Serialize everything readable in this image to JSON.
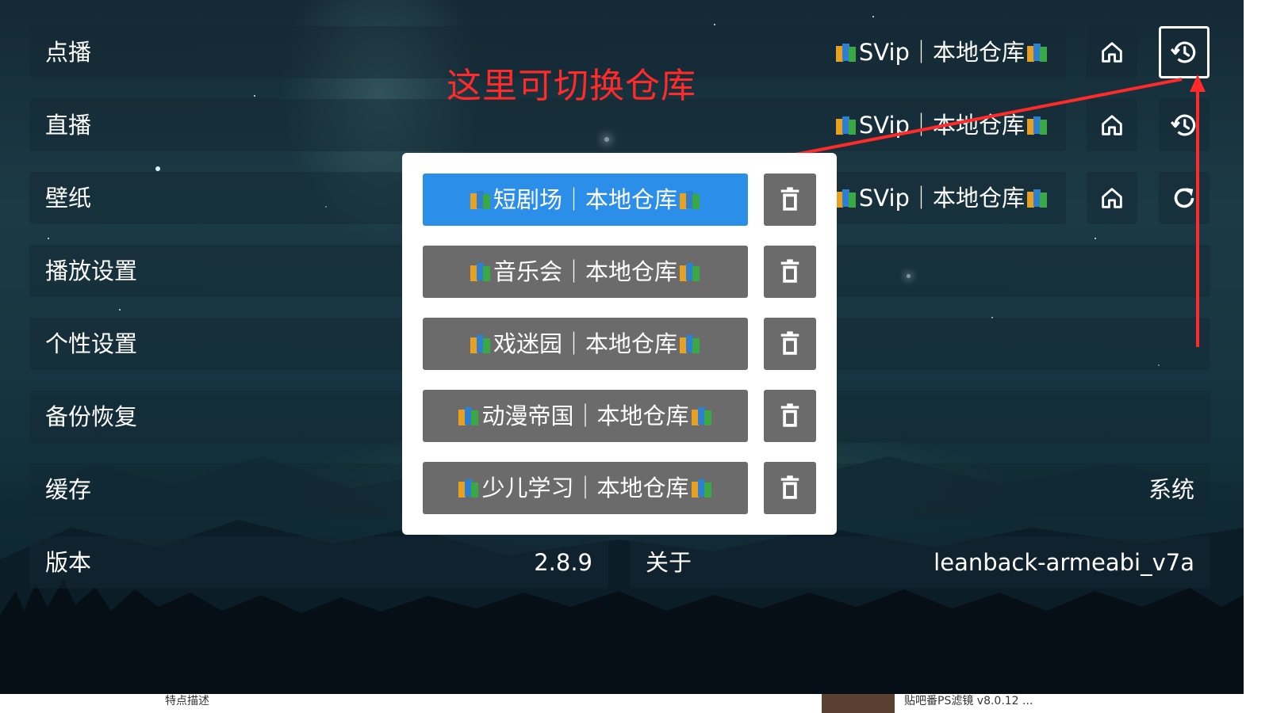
{
  "settings": {
    "rows": [
      {
        "label": "点播",
        "value_name": "SVip",
        "value_repo": "本地仓库"
      },
      {
        "label": "直播",
        "value_name": "SVip",
        "value_repo": "本地仓库"
      },
      {
        "label": "壁纸",
        "value_name": "SVip",
        "value_repo": "本地仓库"
      },
      {
        "label": "播放设置"
      },
      {
        "label": "个性设置"
      },
      {
        "label": "备份恢复"
      },
      {
        "label": "缓存",
        "value": "系统"
      }
    ],
    "version": {
      "label": "版本",
      "value": "2.8.9"
    },
    "about": {
      "label": "关于",
      "value": "leanback-armeabi_v7a"
    },
    "separator": "｜"
  },
  "annotation": {
    "text": "这里可切换仓库",
    "color": "#ff2a2a"
  },
  "dialog": {
    "items": [
      {
        "name": "短剧场",
        "repo": "本地仓库",
        "active": true
      },
      {
        "name": "音乐会",
        "repo": "本地仓库",
        "active": false
      },
      {
        "name": "戏迷园",
        "repo": "本地仓库",
        "active": false
      },
      {
        "name": "动漫帝国",
        "repo": "本地仓库",
        "active": false
      },
      {
        "name": "少儿学习",
        "repo": "本地仓库",
        "active": false
      }
    ],
    "active_color": "#2b8fea",
    "item_color": "#6b6b6b"
  },
  "icons": {
    "home": "home-icon",
    "history": "history-icon",
    "refresh": "refresh-icon",
    "delete": "trash-icon",
    "book": "books-icon"
  },
  "bottom_strip": {
    "left_text": "特点描述",
    "right_text": "贴吧番PS滤镜 v8.0.12 ..."
  }
}
